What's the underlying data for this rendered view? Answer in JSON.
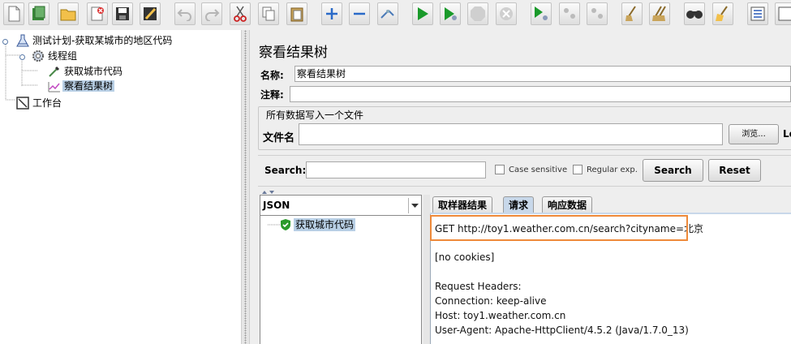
{
  "toolbar": {
    "buttons": [
      "new",
      "templates",
      "open",
      "close",
      "save",
      "save-as-clean",
      "undo",
      "redo",
      "cut",
      "copy",
      "paste",
      "expand",
      "collapse",
      "toggle",
      "start",
      "start-no-pauses",
      "stop",
      "shutdown",
      "remote-start",
      "remote-stop",
      "remote-exit",
      "clear",
      "clear-all",
      "search",
      "reset-search",
      "function-helper",
      "help"
    ]
  },
  "tree": {
    "plan": "测试计划-获取某城市的地区代码",
    "thread_group": "线程组",
    "sampler": "获取城市代码",
    "listener": "察看结果树",
    "workbench": "工作台"
  },
  "panel": {
    "title": "察看结果树",
    "name_label": "名称:",
    "name_value": "察看结果树",
    "comment_label": "注释:",
    "comment_value": "",
    "file_legend": "所有数据写入一个文件",
    "filename_label": "文件名",
    "filename_value": "",
    "browse_label": "浏览...",
    "log_label": "Lo"
  },
  "search": {
    "label": "Search:",
    "value": "",
    "case_sensitive": "Case sensitive",
    "regex": "Regular exp.",
    "search_button": "Search",
    "reset_button": "Reset"
  },
  "results": {
    "renderer": "JSON",
    "items": [
      {
        "label": "获取城市代码",
        "status": "success"
      }
    ],
    "tabs": [
      "取样器结果",
      "请求",
      "响应数据"
    ],
    "active_tab": 1,
    "request_line": "GET http://toy1.weather.com.cn/search?cityname=北京",
    "lines": [
      "[no cookies]",
      "",
      "Request Headers:",
      "Connection: keep-alive",
      "Host: toy1.weather.com.cn",
      "User-Agent: Apache-HttpClient/4.5.2 (Java/1.7.0_13)"
    ]
  },
  "colors": {
    "highlight_border": "#ee8a3a",
    "tree_selection": "#b8cfe5",
    "success_green": "#2a9a2a"
  }
}
